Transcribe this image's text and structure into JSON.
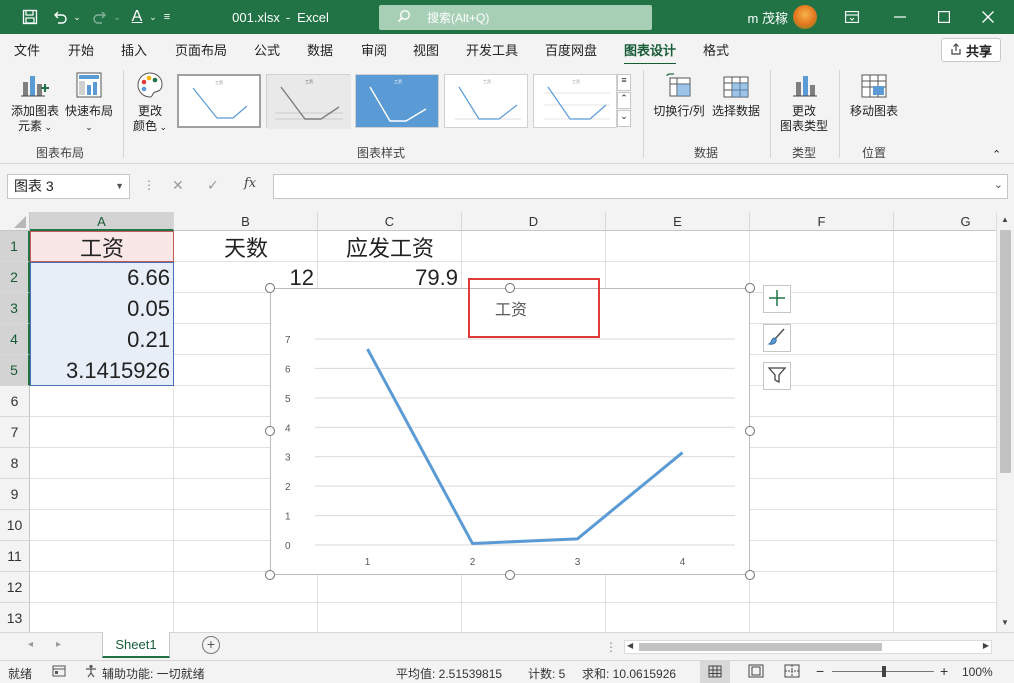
{
  "window": {
    "filename": "001.xlsx",
    "separator": "-",
    "app": "Excel",
    "search_placeholder": "搜索(Alt+Q)",
    "user": "m 茂稼",
    "brand_color": "#217346"
  },
  "ribbon_tabs": [
    {
      "label": "文件"
    },
    {
      "label": "开始"
    },
    {
      "label": "插入"
    },
    {
      "label": "页面布局"
    },
    {
      "label": "公式"
    },
    {
      "label": "数据"
    },
    {
      "label": "审阅"
    },
    {
      "label": "视图"
    },
    {
      "label": "开发工具"
    },
    {
      "label": "百度网盘"
    },
    {
      "label": "图表设计"
    },
    {
      "label": "格式"
    }
  ],
  "active_tab": "图表设计",
  "share_label": "共享",
  "ribbon": {
    "add_element": {
      "line1": "添加图表",
      "line2": "元素"
    },
    "quick_layout": {
      "line1": "快速布局"
    },
    "change_colors": {
      "line1": "更改",
      "line2": "颜色"
    },
    "group_layout": "图表布局",
    "group_styles": "图表样式",
    "switch_row_col": "切换行/列",
    "select_data": "选择数据",
    "group_data": "数据",
    "change_type": {
      "line1": "更改",
      "line2": "图表类型"
    },
    "group_type": "类型",
    "move_chart": "移动图表",
    "group_location": "位置",
    "style_thumb_title": "工资"
  },
  "formula_bar": {
    "name_box": "图表 3",
    "fx": "fx",
    "formula": ""
  },
  "columns": [
    "A",
    "B",
    "C",
    "D",
    "E",
    "F",
    "G"
  ],
  "rows": [
    "1",
    "2",
    "3",
    "4",
    "5",
    "6",
    "7",
    "8",
    "9",
    "10",
    "11",
    "12",
    "13"
  ],
  "cells": {
    "A1": "工资",
    "B1": "天数",
    "C1": "应发工资",
    "A2": "6.66",
    "B2": "12",
    "C2": "79.9",
    "A3": "0.05",
    "A4": "0.21",
    "A5": "3.1415926"
  },
  "chart_data": {
    "type": "line",
    "title": "工资",
    "categories": [
      "1",
      "2",
      "3",
      "4"
    ],
    "series": [
      {
        "values": [
          6.66,
          0.05,
          0.21,
          3.1415926
        ],
        "color": "#5b9bd5"
      }
    ],
    "ylim": [
      0,
      7
    ],
    "yticks": [
      "0",
      "1",
      "2",
      "3",
      "4",
      "5",
      "6",
      "7"
    ],
    "grid": true,
    "legend": "none"
  },
  "sheet_tab": "Sheet1",
  "status": {
    "ready": "就绪",
    "accessibility": "辅助功能: 一切就绪",
    "average": "平均值: 2.51539815",
    "count": "计数: 5",
    "sum": "求和: 10.0615926",
    "zoom": "100%"
  },
  "icons": [
    "save-icon",
    "undo-icon",
    "redo-icon",
    "font-color-icon",
    "search-icon",
    "ribbon-display-icon",
    "minimize-icon",
    "maximize-icon",
    "close-icon",
    "chart-elements-icon",
    "chart-styles-icon",
    "chart-filter-icon"
  ]
}
